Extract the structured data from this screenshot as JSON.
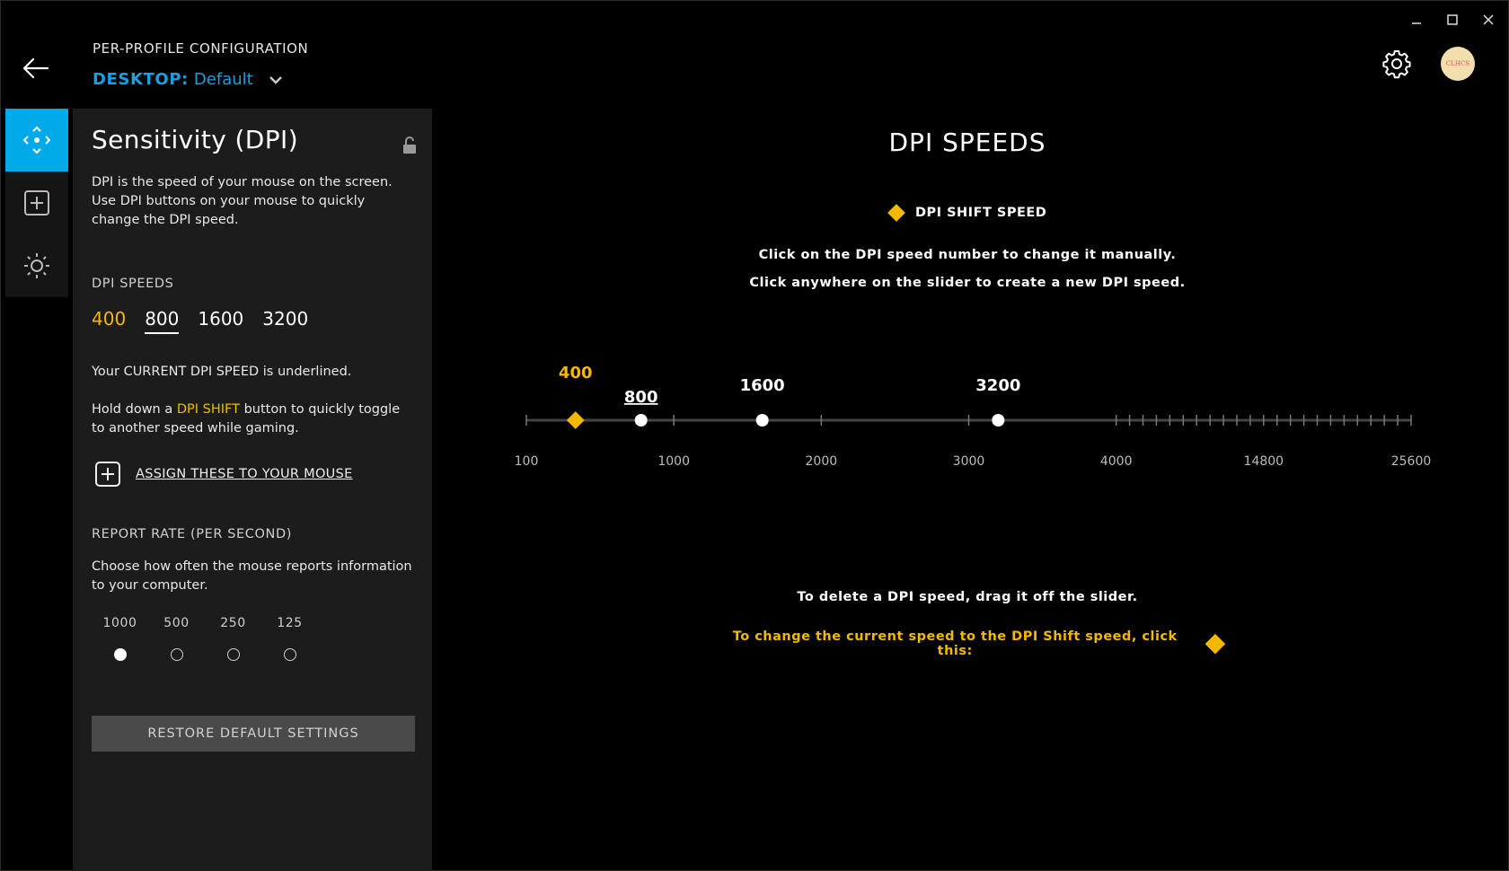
{
  "header": {
    "title": "PER-PROFILE CONFIGURATION",
    "profile_kind": "DESKTOP:",
    "profile_name": "Default",
    "avatar_text": "CLHCS"
  },
  "panel": {
    "title": "Sensitivity (DPI)",
    "description": "DPI is the speed of your mouse on the screen. Use DPI buttons on your mouse to quickly change the DPI speed.",
    "dpi_speeds_label": "DPI SPEEDS",
    "dpi_speeds": [
      "400",
      "800",
      "1600",
      "3200"
    ],
    "current_note": "Your CURRENT DPI SPEED is underlined.",
    "shift_note_pre": "Hold down a ",
    "shift_note_hl": "DPI SHIFT",
    "shift_note_post": " button to quickly toggle to another speed while gaming.",
    "assign_label": "ASSIGN THESE TO YOUR MOUSE",
    "report_rate_label": "REPORT RATE (PER SECOND)",
    "report_rate_desc": "Choose how often the mouse reports information to your computer.",
    "report_rates": [
      "1000",
      "500",
      "250",
      "125"
    ],
    "report_rate_selected": "1000",
    "restore_label": "RESTORE DEFAULT SETTINGS"
  },
  "main": {
    "title": "DPI SPEEDS",
    "legend_label": "DPI SHIFT SPEED",
    "instr_1": "Click on the DPI speed number to change it manually.",
    "instr_2": "Click anywhere on the slider to create a new DPI speed.",
    "delete_note": "To delete a DPI speed, drag it off the slider.",
    "shift_note": "To change the current speed to the DPI Shift speed, click this:"
  },
  "colors": {
    "accent": "#00a9e8",
    "profile": "#1aa0e0",
    "shift": "#f5b800",
    "panel_bg": "#1c1c1c"
  },
  "slider": {
    "axis_labels": [
      "100",
      "1000",
      "2000",
      "3000",
      "4000",
      "14800",
      "25600"
    ],
    "speeds": [
      {
        "value": 400,
        "label": "400",
        "kind": "shift"
      },
      {
        "value": 800,
        "label": "800",
        "kind": "current"
      },
      {
        "value": 1600,
        "label": "1600",
        "kind": "normal"
      },
      {
        "value": 3200,
        "label": "3200",
        "kind": "normal"
      }
    ]
  }
}
